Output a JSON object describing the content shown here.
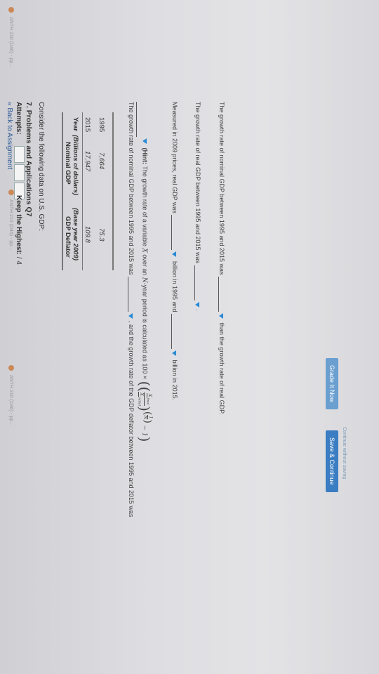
{
  "nav": {
    "back_label": "« Back to Assignment"
  },
  "attempts": {
    "label": "Attempts:",
    "keep_label": "Keep the Highest:",
    "keep_value": "/ 4"
  },
  "question": {
    "title": "7. Problems and Applications Q7",
    "intro": "Consider the following data on U.S. GDP:"
  },
  "table": {
    "headers": {
      "year": "Year",
      "gdp_line1": "Nominal GDP",
      "gdp_line2": "(Billions of dollars)",
      "def_line1": "GDP Deflator",
      "def_line2": "(Base year 2009)"
    },
    "rows": [
      {
        "year": "2015",
        "gdp": "17,947",
        "deflator": "109.8"
      },
      {
        "year": "1995",
        "gdp": "7,664",
        "deflator": "75.3"
      }
    ]
  },
  "q1": {
    "text_a": "The growth rate of nominal GDP between 1995 and 2015 was",
    "text_b": ", and the growth rate of the GDP deflator between 1995 and 2015 was",
    "hint_label": "(Hint:",
    "hint_text": "The growth rate of a variable",
    "hint_x": "X",
    "hint_over": "over an",
    "hint_n": "N",
    "hint_rest": "-year period is calculated as 100 ×",
    "frac_num": "X",
    "frac_num_sub": "final",
    "frac_den": "X",
    "frac_den_sub": "initial",
    "exp_num": "1",
    "exp_den": "N",
    "minus_one": "− 1",
    "close": ")"
  },
  "q2": {
    "text_a": "Measured in 2009 prices, real GDP was",
    "text_b": "billion in 1995 and",
    "text_c": "billion in 2015."
  },
  "q3": {
    "text_a": "The growth rate of real GDP between 1995 and 2015 was",
    "text_b": "."
  },
  "q4": {
    "text_a": "The growth rate of nominal GDP between 1995 and 2015 was",
    "text_b": "than the growth rate of real GDP."
  },
  "buttons": {
    "grade": "Grade It Now",
    "save": "Save & Continue",
    "continue_without": "Continue without saving"
  },
  "taskbar": {
    "item1": "ANTH 210 (D46) - pp...",
    "item2": "ANTH 210 (D46) - pp...",
    "item3": "ANTH 210 (D46) - pp..."
  }
}
